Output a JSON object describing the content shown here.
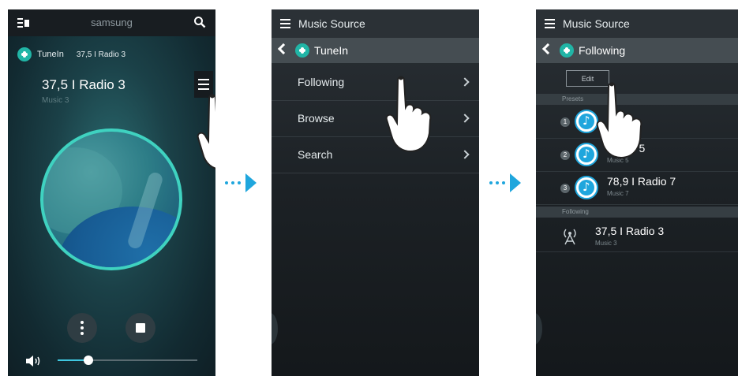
{
  "screen1": {
    "app_title": "samsung",
    "source_name": "TuneIn",
    "source_station": "37,5 I Radio 3",
    "now_playing_title": "37,5 I Radio 3",
    "now_playing_sub": "Music 3",
    "volume_fraction": 0.22
  },
  "screen2": {
    "header": "Music Source",
    "back_label": "TuneIn",
    "menu_items": [
      "Following",
      "Browse",
      "Search"
    ]
  },
  "screen3": {
    "header": "Music Source",
    "back_label": "Following",
    "edit_label": "Edit",
    "presets_header": "Presets",
    "presets": [
      {
        "num": "1",
        "title": "",
        "sub": ""
      },
      {
        "num": "2",
        "title": "Radio 5",
        "sub": "Music 5"
      },
      {
        "num": "3",
        "title": "78,9 I Radio 7",
        "sub": "Music 7"
      }
    ],
    "following_header": "Following",
    "following": [
      {
        "title": "37,5 I Radio 3",
        "sub": "Music 3"
      }
    ]
  },
  "colors": {
    "accent": "#1fa6dd",
    "teal": "#21b5a6"
  }
}
